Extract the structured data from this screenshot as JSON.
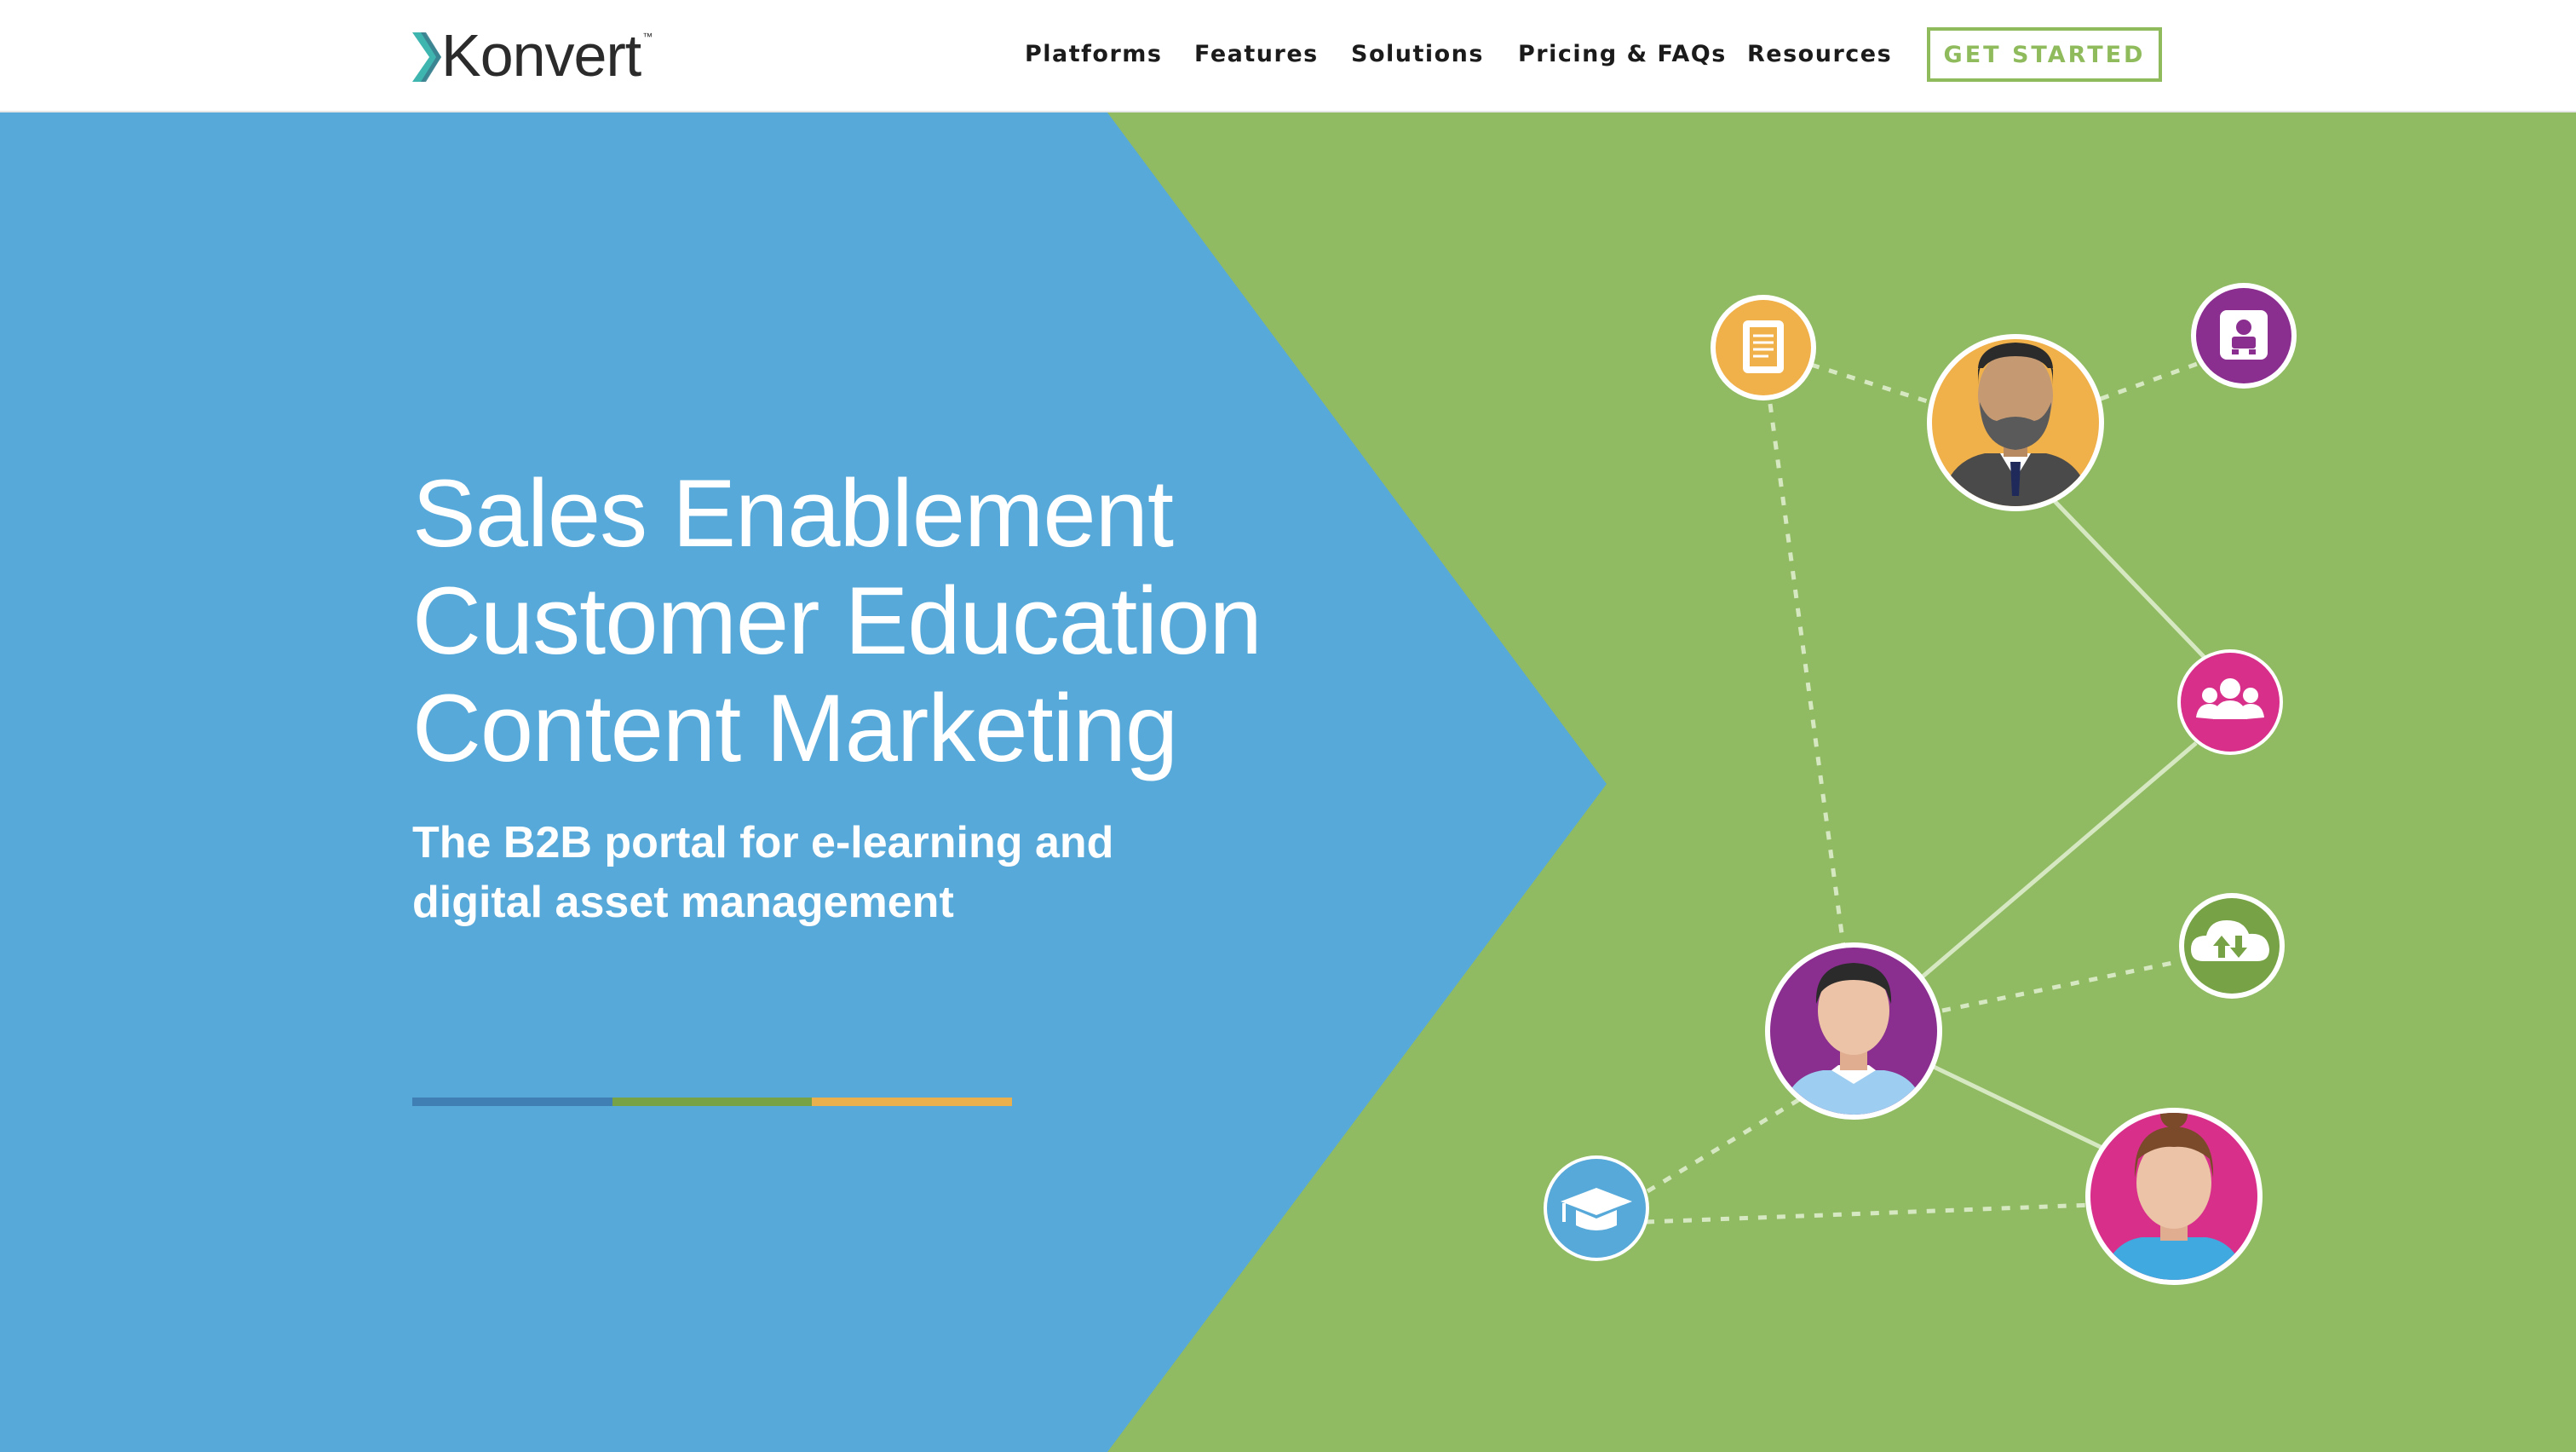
{
  "brand": {
    "name": "Konvert",
    "tm": "™"
  },
  "nav": {
    "items": [
      {
        "label": "Platforms"
      },
      {
        "label": "Features"
      },
      {
        "label": "Solutions"
      },
      {
        "label": "Pricing & FAQs"
      },
      {
        "label": "Resources"
      }
    ],
    "cta_label": "GET STARTED"
  },
  "hero": {
    "headline": [
      "Sales Enablement",
      "Customer Education",
      "Content Marketing"
    ],
    "subhead_line1": "The B2B portal for e-learning and",
    "subhead_line2": "digital asset management"
  },
  "colors": {
    "blue": "#57a9d9",
    "green": "#90bb62",
    "accent_teal": "#3a8a97",
    "orange": "#f0b04a",
    "purple": "#8a2f8f",
    "magenta": "#d8308a",
    "bar_blue": "#3f7fb3",
    "bar_green": "#77a246",
    "bar_orange": "#eab04d"
  },
  "icons": [
    "document-icon",
    "org-chart-icon",
    "team-icon",
    "cloud-sync-icon",
    "graduation-cap-icon",
    "bearded-man-avatar",
    "man-avatar",
    "woman-avatar"
  ]
}
